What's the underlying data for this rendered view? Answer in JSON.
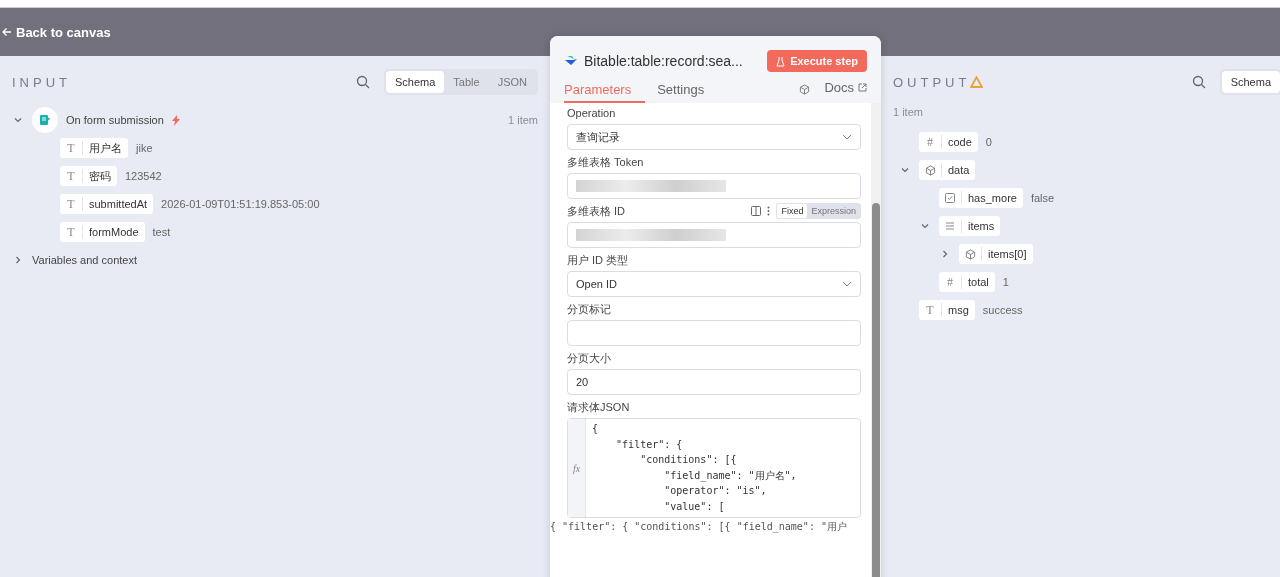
{
  "header": {
    "back_label": "Back to canvas"
  },
  "input": {
    "title": "INPUT",
    "view_tabs": [
      {
        "label": "Schema",
        "selected": true
      },
      {
        "label": "Table",
        "selected": false
      },
      {
        "label": "JSON",
        "selected": false
      }
    ],
    "node": {
      "name": "On form submission",
      "expanded": true,
      "count": "1 item",
      "fields": [
        {
          "kind": "string",
          "icon": "T",
          "key": "用户名",
          "value": "jike"
        },
        {
          "kind": "string",
          "icon": "T",
          "key": "密码",
          "value": "123542"
        },
        {
          "kind": "string",
          "icon": "T",
          "key": "submittedAt",
          "value": "2026-01-09T01:51:19.853-05:00"
        },
        {
          "kind": "string",
          "icon": "T",
          "key": "formMode",
          "value": "test"
        }
      ]
    },
    "context": {
      "label": "Variables and context",
      "expanded": false
    }
  },
  "node_panel": {
    "title": "Bitable:table:record:sea...",
    "execute_label": "Execute step",
    "tabs": [
      {
        "label": "Parameters",
        "selected": true
      },
      {
        "label": "Settings",
        "selected": false
      }
    ],
    "docs_label": "Docs",
    "params": [
      {
        "kind": "select",
        "label": "Operation",
        "value": "查询记录"
      },
      {
        "kind": "redacted",
        "label": "多维表格 Token"
      },
      {
        "kind": "redacted",
        "label": "多维表格 ID",
        "mode_toggle": [
          {
            "label": "Fixed",
            "selected": true
          },
          {
            "label": "Expression",
            "selected": false
          }
        ]
      },
      {
        "kind": "select",
        "label": "用户 ID 类型",
        "value": "Open ID"
      },
      {
        "kind": "text",
        "label": "分页标记"
      },
      {
        "kind": "text",
        "label": "分页大小",
        "value": "20"
      },
      {
        "kind": "code",
        "label": "请求体JSON",
        "fx_label": "fx",
        "lines": [
          "{",
          "    \"filter\": {",
          "        \"conditions\": [{",
          "            \"field_name\": \"用户名\",",
          "            \"operator\": \"is\",",
          "            \"value\": ["
        ],
        "preview": "{ \"filter\": { \"conditions\": [{ \"field_name\": \"用户"
      }
    ]
  },
  "output": {
    "title": "OUTPUT",
    "warning": true,
    "view_tabs": [
      {
        "label": "Schema",
        "selected": true
      }
    ],
    "count": "1 item",
    "fields": [
      {
        "kind": "number",
        "icon": "#",
        "key": "code",
        "value": "0"
      },
      {
        "kind": "object",
        "key": "data",
        "expanded": true,
        "children": [
          {
            "kind": "boolean",
            "key": "has_more",
            "value": "false"
          },
          {
            "kind": "array",
            "key": "items",
            "expanded": true,
            "children": [
              {
                "kind": "object",
                "key": "items[0]",
                "expanded": false
              }
            ]
          },
          {
            "kind": "number",
            "icon": "#",
            "key": "total",
            "value": "1"
          }
        ]
      },
      {
        "kind": "string",
        "icon": "T",
        "key": "msg",
        "value": "success"
      }
    ]
  }
}
